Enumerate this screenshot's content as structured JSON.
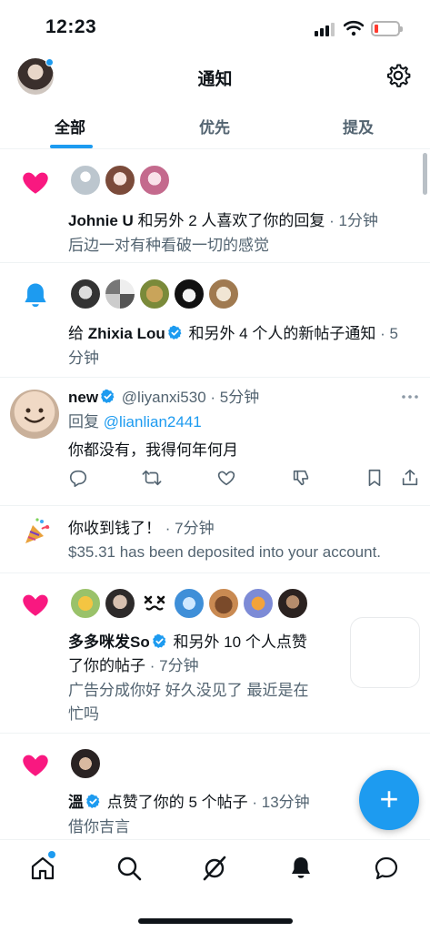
{
  "status_bar": {
    "time": "12:23"
  },
  "header": {
    "title": "通知"
  },
  "tabs": [
    {
      "label": "全部"
    },
    {
      "label": "优先"
    },
    {
      "label": "提及"
    }
  ],
  "notifications": [
    {
      "type": "like",
      "actor": "Johnie U",
      "text": " 和另外 2 人喜欢了你的回复",
      "time": "1分钟",
      "snippet": "后边一对有种看破一切的感觉"
    },
    {
      "type": "subscription",
      "prefix": "给 ",
      "actor": "Zhixia Lou",
      "text": " 和另外 4 个人的新帖子通知",
      "time": "5",
      "time2": "分钟"
    },
    {
      "type": "reply",
      "name": "new",
      "handle": "@liyanxi530",
      "time": "5分钟",
      "reply_prefix": "回复 ",
      "reply_to": "@lianlian2441",
      "body": "你都没有，我得何年何月"
    },
    {
      "type": "money",
      "title": "你收到钱了！",
      "time": "7分钟",
      "detail": "$35.31 has been deposited into your account."
    },
    {
      "type": "like",
      "actor": "多多咪发So",
      "text": " 和另外 10 个人点赞",
      "text2": "了你的帖子",
      "time": "7分钟",
      "snippet": "广告分成你好 好久没见了 最近是在",
      "snippet2": "忙吗"
    },
    {
      "type": "like",
      "actor": "溫",
      "text": " 点赞了你的 5 个帖子",
      "time": "13分钟",
      "snippet": "借你吉言"
    }
  ],
  "sep": " · ",
  "colors": {
    "accent": "#1d9bf0",
    "like": "#f91880",
    "text": "#0f1419",
    "muted": "#536471"
  },
  "icons": {
    "nav": [
      "home-icon",
      "search-icon",
      "grok-icon",
      "bell-icon",
      "messages-icon"
    ],
    "actions": [
      "reply-icon",
      "retweet-icon",
      "like-icon",
      "dislike-icon",
      "bookmark-icon",
      "share-icon"
    ]
  }
}
